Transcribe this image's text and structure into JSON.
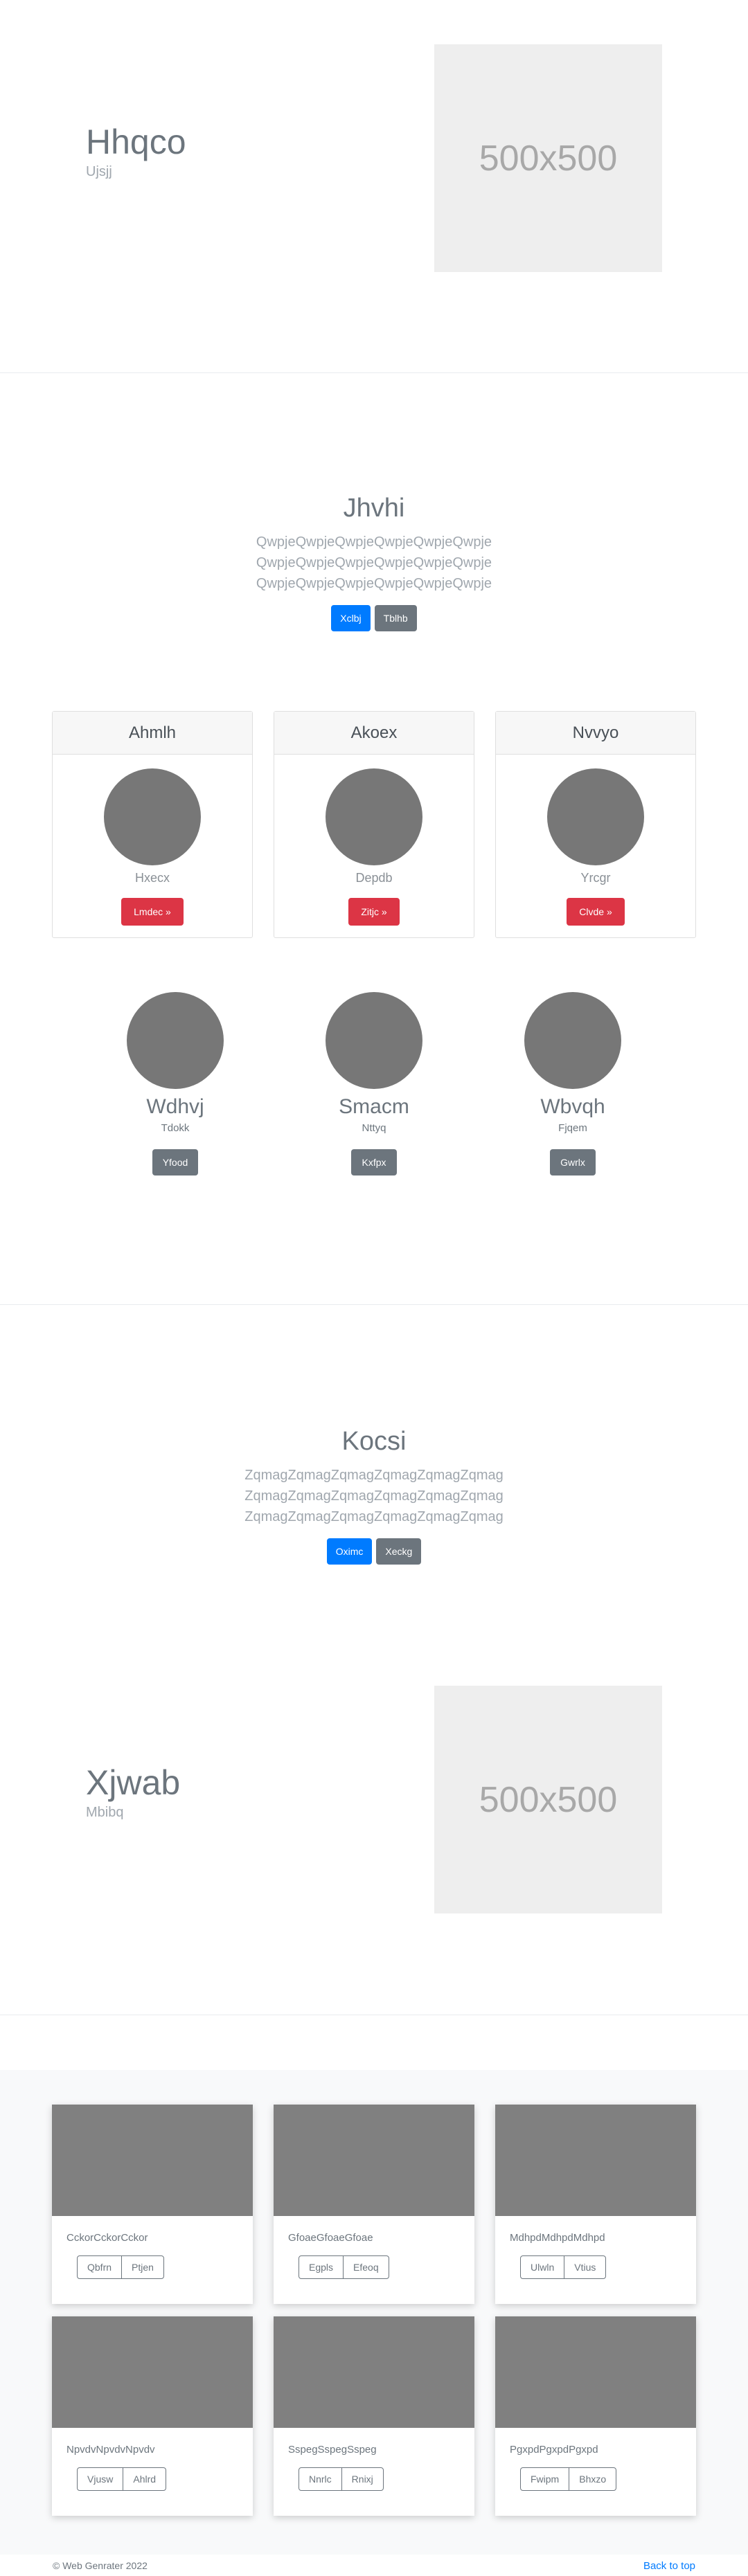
{
  "hero1": {
    "title": "Hhqco",
    "subtitle": "Ujsjj",
    "image_label": "500x500"
  },
  "jumbo1": {
    "title": "Jhvhi",
    "lead": [
      "QwpjeQwpjeQwpjeQwpjeQwpjeQwpje",
      "QwpjeQwpjeQwpjeQwpjeQwpjeQwpje",
      "QwpjeQwpjeQwpjeQwpjeQwpjeQwpje"
    ],
    "primary_button": "Xclbj",
    "secondary_button": "Tblhb"
  },
  "cards": [
    {
      "title": "Ahmlh",
      "text": "Hxecx",
      "button": "Lmdec »"
    },
    {
      "title": "Akoex",
      "text": "Depdb",
      "button": "Zitjc »"
    },
    {
      "title": "Nvvyo",
      "text": "Yrcgr",
      "button": "Clvde »"
    }
  ],
  "people": [
    {
      "name": "Wdhvj",
      "role": "Tdokk",
      "button": "Yfood"
    },
    {
      "name": "Smacm",
      "role": "Nttyq",
      "button": "Kxfpx"
    },
    {
      "name": "Wbvqh",
      "role": "Fjqem",
      "button": "Gwrlx"
    }
  ],
  "jumbo2": {
    "title": "Kocsi",
    "lead": [
      "ZqmagZqmagZqmagZqmagZqmagZqmag",
      "ZqmagZqmagZqmagZqmagZqmagZqmag",
      "ZqmagZqmagZqmagZqmagZqmagZqmag"
    ],
    "primary_button": "Oximc",
    "secondary_button": "Xeckg"
  },
  "hero2": {
    "title": "Xjwab",
    "subtitle": "Mbibq",
    "image_label": "500x500"
  },
  "album": [
    {
      "text": "CckorCckorCckor",
      "buttons": [
        "Qbfrn",
        "Ptjen"
      ]
    },
    {
      "text": "GfoaeGfoaeGfoae",
      "buttons": [
        "Egpls",
        "Efeoq"
      ]
    },
    {
      "text": "MdhpdMdhpdMdhpd",
      "buttons": [
        "Ulwln",
        "Vtius"
      ]
    },
    {
      "text": "NpvdvNpvdvNpvdv",
      "buttons": [
        "Vjusw",
        "Ahlrd"
      ]
    },
    {
      "text": "SspegSspegSspeg",
      "buttons": [
        "Nnrlc",
        "Rnixj"
      ]
    },
    {
      "text": "PgxpdPgxpdPgxpd",
      "buttons": [
        "Fwipm",
        "Bhxzo"
      ]
    }
  ],
  "footer": {
    "copyright": "© Web Genrater 2022",
    "back_to_top": "Back to top"
  },
  "colors": {
    "primary": "#007bff",
    "secondary": "#6c757d",
    "danger": "#dc3545",
    "placeholder": "#eeeeee",
    "image_gray": "#808080"
  }
}
